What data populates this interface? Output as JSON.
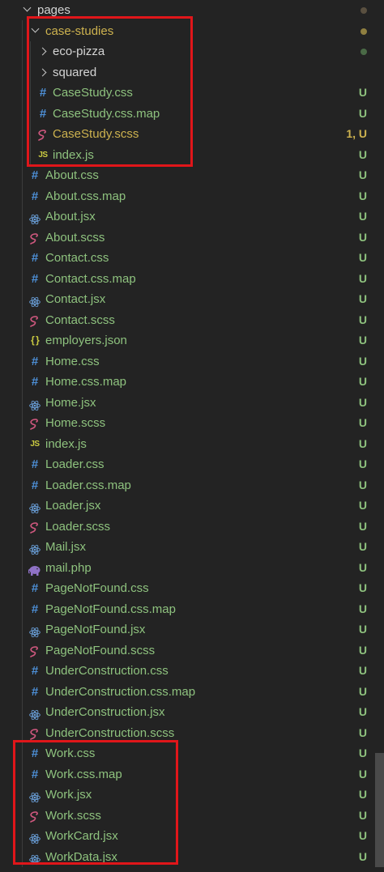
{
  "explorer": {
    "root_folder": {
      "label": "pages",
      "dot_color": "#5a5040"
    },
    "subfolder": {
      "label": "case-studies",
      "dot_color": "#8f7f40"
    },
    "items": [
      {
        "label": "eco-pizza",
        "kind": "folder-collapsed",
        "status": "",
        "status_dot_color": "#4a6a46"
      },
      {
        "label": "squared",
        "kind": "folder-collapsed",
        "status": ""
      },
      {
        "label": "CaseStudy.css",
        "kind": "css",
        "status": "U"
      },
      {
        "label": "CaseStudy.css.map",
        "kind": "css",
        "status": "U"
      },
      {
        "label": "CaseStudy.scss",
        "kind": "scss",
        "status": "1, U"
      },
      {
        "label": "index.js",
        "kind": "js",
        "status": "U"
      },
      {
        "label": "About.css",
        "kind": "css",
        "status": "U"
      },
      {
        "label": "About.css.map",
        "kind": "css",
        "status": "U"
      },
      {
        "label": "About.jsx",
        "kind": "jsx",
        "status": "U"
      },
      {
        "label": "About.scss",
        "kind": "scss",
        "status": "U"
      },
      {
        "label": "Contact.css",
        "kind": "css",
        "status": "U"
      },
      {
        "label": "Contact.css.map",
        "kind": "css",
        "status": "U"
      },
      {
        "label": "Contact.jsx",
        "kind": "jsx",
        "status": "U"
      },
      {
        "label": "Contact.scss",
        "kind": "scss",
        "status": "U"
      },
      {
        "label": "employers.json",
        "kind": "json",
        "status": "U"
      },
      {
        "label": "Home.css",
        "kind": "css",
        "status": "U"
      },
      {
        "label": "Home.css.map",
        "kind": "css",
        "status": "U"
      },
      {
        "label": "Home.jsx",
        "kind": "jsx",
        "status": "U"
      },
      {
        "label": "Home.scss",
        "kind": "scss",
        "status": "U"
      },
      {
        "label": "index.js",
        "kind": "js",
        "status": "U"
      },
      {
        "label": "Loader.css",
        "kind": "css",
        "status": "U"
      },
      {
        "label": "Loader.css.map",
        "kind": "css",
        "status": "U"
      },
      {
        "label": "Loader.jsx",
        "kind": "jsx",
        "status": "U"
      },
      {
        "label": "Loader.scss",
        "kind": "scss",
        "status": "U"
      },
      {
        "label": "Mail.jsx",
        "kind": "jsx",
        "status": "U"
      },
      {
        "label": "mail.php",
        "kind": "php",
        "status": "U"
      },
      {
        "label": "PageNotFound.css",
        "kind": "css",
        "status": "U"
      },
      {
        "label": "PageNotFound.css.map",
        "kind": "css",
        "status": "U"
      },
      {
        "label": "PageNotFound.jsx",
        "kind": "jsx",
        "status": "U"
      },
      {
        "label": "PageNotFound.scss",
        "kind": "scss",
        "status": "U"
      },
      {
        "label": "UnderConstruction.css",
        "kind": "css",
        "status": "U"
      },
      {
        "label": "UnderConstruction.css.map",
        "kind": "css",
        "status": "U"
      },
      {
        "label": "UnderConstruction.jsx",
        "kind": "jsx",
        "status": "U"
      },
      {
        "label": "UnderConstruction.scss",
        "kind": "scss",
        "status": "U"
      },
      {
        "label": "Work.css",
        "kind": "css",
        "status": "U"
      },
      {
        "label": "Work.css.map",
        "kind": "css",
        "status": "U"
      },
      {
        "label": "Work.jsx",
        "kind": "jsx",
        "status": "U"
      },
      {
        "label": "Work.scss",
        "kind": "scss",
        "status": "U"
      },
      {
        "label": "WorkCard.jsx",
        "kind": "jsx",
        "status": "U"
      },
      {
        "label": "WorkData.jsx",
        "kind": "jsx",
        "status": "U"
      }
    ],
    "icons": {
      "css": "hash-icon",
      "scss": "sass-icon",
      "jsx": "react-icon",
      "js": "js-icon",
      "json": "json-braces-icon",
      "php": "php-elephant-icon",
      "folder": "chevron-icon"
    },
    "icon_glyphs": {
      "css": "#",
      "js": "JS",
      "json": "{ }"
    },
    "colors": {
      "background": "#232323",
      "untracked_green": "#8ec27e",
      "warning_yellow": "#cdb24f",
      "css_blue": "#4d8fd6",
      "react_blue": "#6a9fd8",
      "sass_pink": "#d0587f",
      "js_yellow": "#cbcb41",
      "php_purple": "#8f72c6",
      "highlight_red": "#e0161a"
    }
  }
}
